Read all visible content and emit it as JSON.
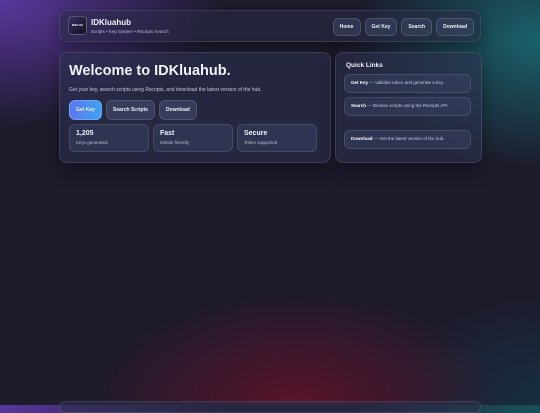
{
  "header": {
    "logo_text": "IDKLUA HUB",
    "title": "IDKluahub",
    "subtitle": "Scripts • Key System • Rscripts Search",
    "nav": [
      "Home",
      "Get Key",
      "Search",
      "Download"
    ]
  },
  "hero": {
    "title": "Welcome to IDKluahub.",
    "description": "Get your key, search scripts using Rscripts, and download the latest version of the hub.",
    "actions": [
      "Get Key",
      "Search Scripts",
      "Download"
    ],
    "stats": [
      {
        "value": "1,205",
        "label": "Keys generated"
      },
      {
        "value": "Fast",
        "label": "Mobile friendly"
      },
      {
        "value": "Secure",
        "label": "Token supported"
      }
    ]
  },
  "quick_links": {
    "title": "Quick Links",
    "items": [
      {
        "name": "Get Key",
        "desc": " — Validate token and generate a key."
      },
      {
        "name": "Search",
        "desc": " — Browse scripts using the Rscripts API."
      },
      {
        "name": "Download",
        "desc": " — Get the latest version of the hub."
      }
    ]
  },
  "colors": {
    "primary_button": "#5b76f2",
    "primary_button_end": "#3fa4ee",
    "background": "#1d1b2c"
  }
}
